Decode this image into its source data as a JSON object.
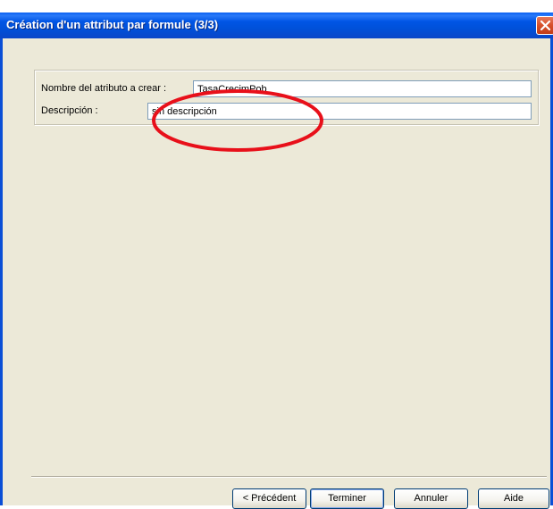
{
  "window": {
    "title": "Création d'un attribut par formule (3/3)"
  },
  "form": {
    "name_label": "Nombre del atributo a crear :",
    "name_value": "TasaCrecimPob",
    "description_label": "Descripción :",
    "description_value": "sin descripción"
  },
  "buttons": {
    "previous": "< Précédent",
    "finish": "Terminer",
    "cancel": "Annuler",
    "help": "Aide"
  },
  "icons": {
    "close": "close-icon"
  },
  "colors": {
    "titlebar": "#0055e5",
    "dialog_bg": "#ece9d8",
    "annotation": "#e8101a",
    "close_button": "#d6502a"
  }
}
